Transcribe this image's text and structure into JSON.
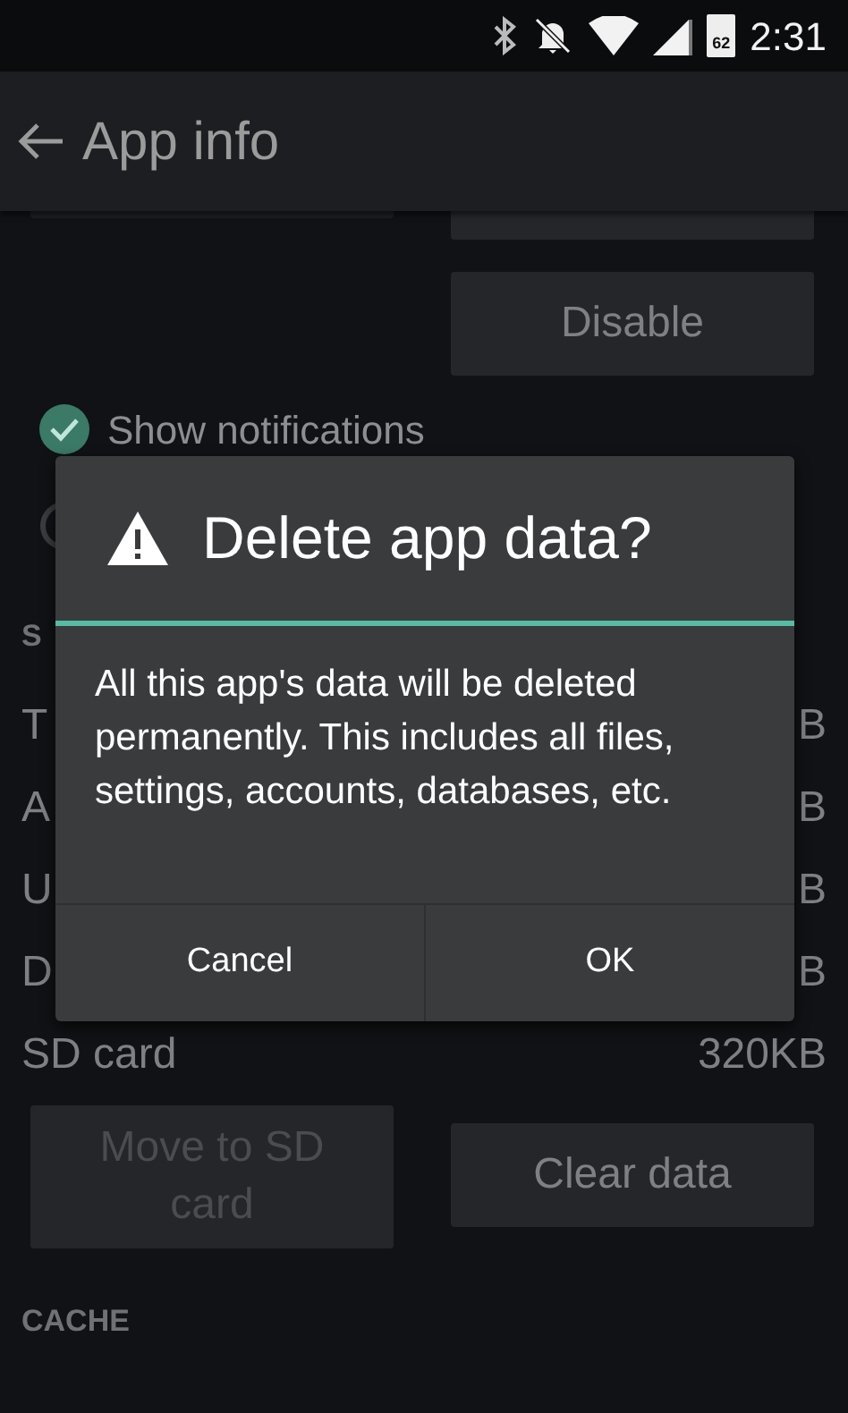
{
  "status_bar": {
    "time": "2:31",
    "battery": "62"
  },
  "app_bar": {
    "title": "App info"
  },
  "top_buttons": [
    {
      "label": "Disable",
      "disabled": false
    }
  ],
  "options": [
    {
      "label": "Show notifications",
      "checked": true
    },
    {
      "checked": false
    }
  ],
  "storage_header": "S",
  "storage_rows": [
    {
      "label": "T",
      "value": "B"
    },
    {
      "label": "A",
      "value": "B"
    },
    {
      "label": "U",
      "value": "B"
    },
    {
      "label": "D",
      "value": "B"
    }
  ],
  "sd_card": {
    "label": "SD card",
    "value": "320KB"
  },
  "storage_buttons": [
    {
      "label": "Move to SD card",
      "disabled": true
    },
    {
      "label": "Clear data",
      "disabled": false
    }
  ],
  "cache_header": "CACHE",
  "dialog": {
    "title": "Delete app data?",
    "message": "All this app's data will be deleted permanently. This includes all files, settings, accounts, databases, etc.",
    "buttons": [
      "Cancel",
      "OK"
    ]
  }
}
